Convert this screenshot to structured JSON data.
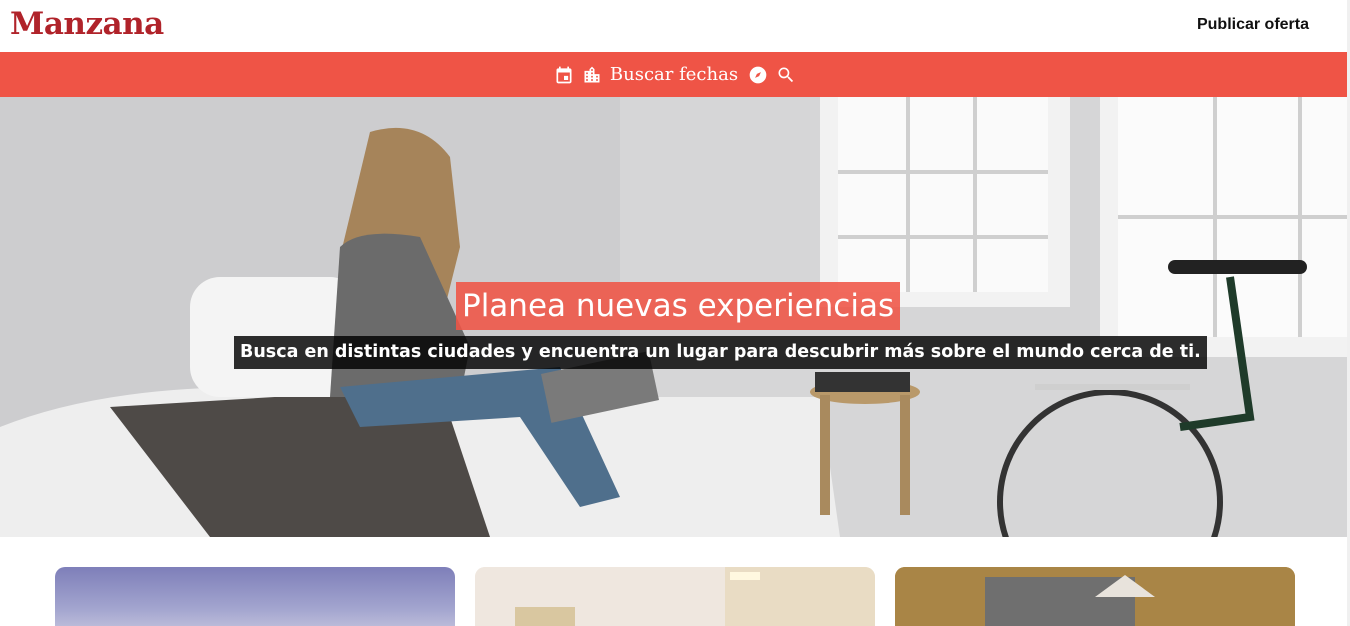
{
  "header": {
    "logo": "Manzana",
    "publish_label": "Publicar oferta"
  },
  "searchbar": {
    "icons": [
      "calendar-icon",
      "city-icon",
      "compass-icon",
      "search-icon"
    ],
    "label": "Buscar fechas"
  },
  "hero": {
    "title": "Planea nuevas experiencias",
    "subtitle": "Busca en distintas ciudades y encuentra un lugar para descubrir más sobre el mundo cerca de ti."
  },
  "colors": {
    "brand": "#b0232a",
    "searchbar": "#ef5446"
  }
}
